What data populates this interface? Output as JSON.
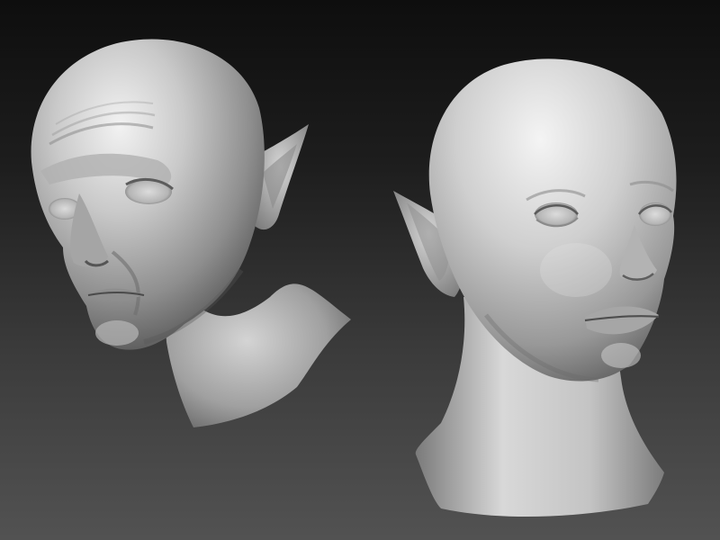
{
  "scene": {
    "background": {
      "top_color": "#0e0e0e",
      "bottom_color": "#525252"
    },
    "material_color": "#bdbdbd",
    "subjects": [
      {
        "name": "male-elf-head-sculpt"
      },
      {
        "name": "female-elf-head-sculpt"
      }
    ]
  }
}
